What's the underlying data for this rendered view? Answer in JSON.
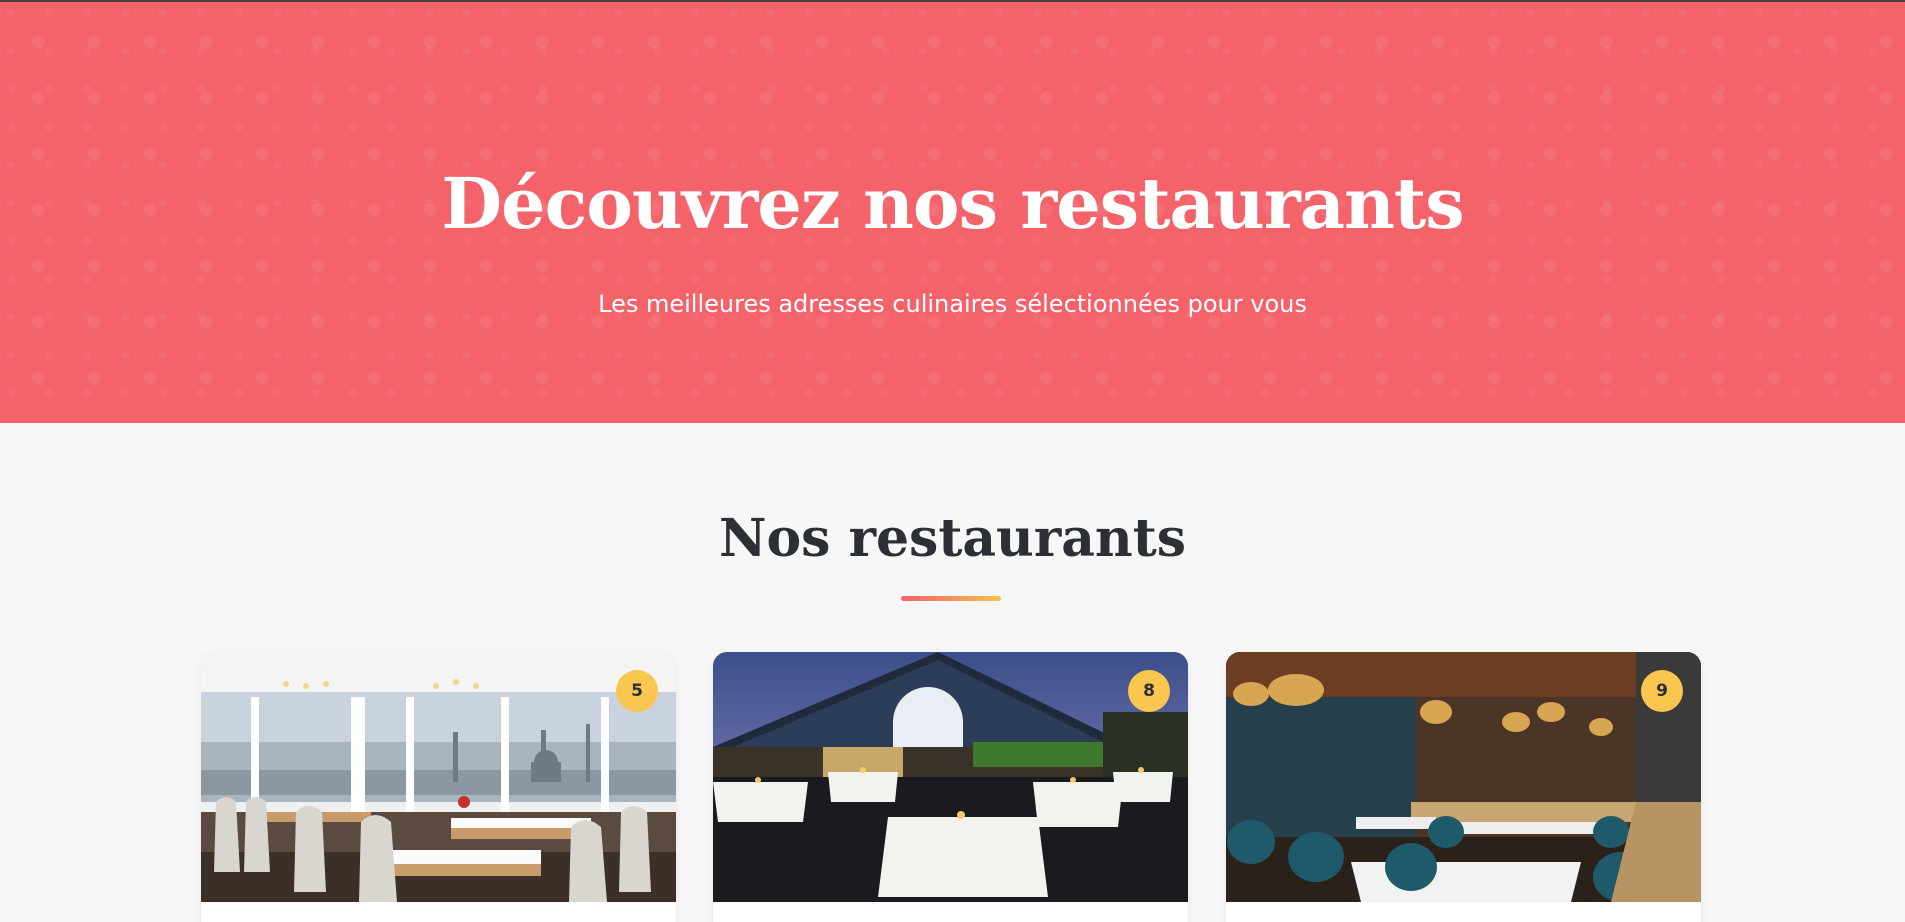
{
  "hero": {
    "title": "Découvrez nos restaurants",
    "subtitle": "Les meilleures adresses culinaires sélectionnées pour vous"
  },
  "section": {
    "title": "Nos restaurants"
  },
  "colors": {
    "hero_background": "#f4626a",
    "badge": "#f9c64f",
    "heading": "#2c3035",
    "underline_start": "#f4626a",
    "underline_end": "#f8c14d"
  },
  "restaurants": [
    {
      "badge": "5"
    },
    {
      "badge": "8"
    },
    {
      "badge": "9"
    }
  ]
}
